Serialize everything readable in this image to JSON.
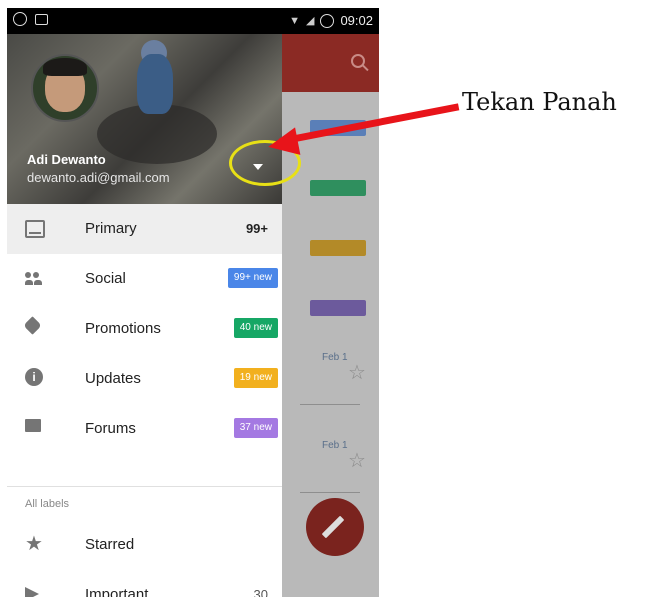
{
  "status_bar": {
    "time": "09:02"
  },
  "account": {
    "name": "Adi Dewanto",
    "email": "dewanto.adi@gmail.com"
  },
  "menu": [
    {
      "label": "Primary",
      "icon": "inbox-icon",
      "count": "99+",
      "selected": true
    },
    {
      "label": "Social",
      "icon": "people-icon",
      "badge": "99+ new",
      "badge_color": "#4a86e8"
    },
    {
      "label": "Promotions",
      "icon": "tag-icon",
      "badge": "40 new",
      "badge_color": "#16a765"
    },
    {
      "label": "Updates",
      "icon": "info-icon",
      "badge": "19 new",
      "badge_color": "#f2b01e"
    },
    {
      "label": "Forums",
      "icon": "forum-icon",
      "badge": "37 new",
      "badge_color": "#a479e2"
    }
  ],
  "labels_section": "All labels",
  "labels": [
    {
      "label": "Starred",
      "icon": "star-icon"
    },
    {
      "label": "Important",
      "icon": "important-icon",
      "count": "30"
    }
  ],
  "annotation": {
    "text": "Tekan Panah",
    "color": "#e8141a",
    "highlight_color": "#e8e016"
  },
  "background_list": {
    "toolbar_color": "#8b2a24",
    "dates": [
      "Feb 1",
      "Feb 1"
    ]
  }
}
